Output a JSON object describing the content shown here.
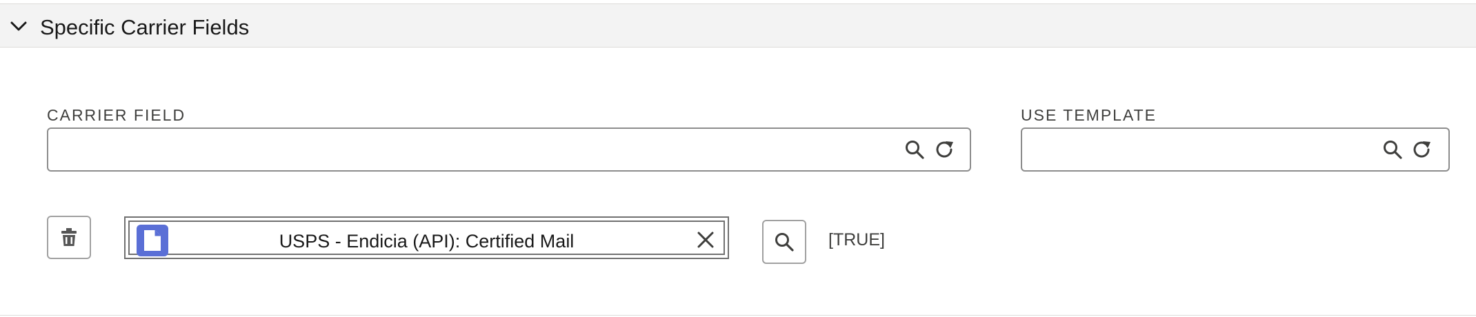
{
  "section": {
    "title": "Specific Carrier Fields",
    "toggle_icon": "chevron-down-icon"
  },
  "carrier_field": {
    "label": "CARRIER FIELD",
    "value": "",
    "search_icon": "search-icon",
    "refresh_icon": "refresh-icon"
  },
  "use_template": {
    "label": "USE TEMPLATE",
    "value": "",
    "search_icon": "search-icon",
    "refresh_icon": "refresh-icon"
  },
  "row": {
    "delete_icon": "trash-icon",
    "selected_value": "USPS - Endicia (API): Certified Mail",
    "record_icon": "document-icon",
    "clear_icon": "close-icon",
    "lookup_icon": "search-icon",
    "boolean_text": "[TRUE]"
  },
  "colors": {
    "header_bg": "#f3f3f3",
    "record_icon": "#5a6fd6",
    "border": "#8c8c8c",
    "text": "#181818"
  }
}
